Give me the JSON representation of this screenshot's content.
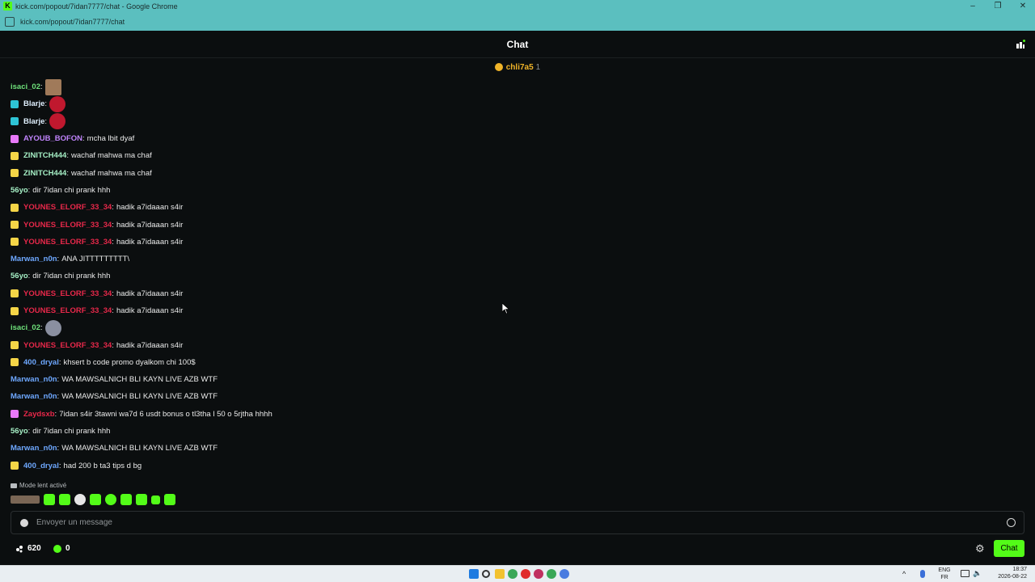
{
  "window": {
    "title": "kick.com/popout/7idan7777/chat - Google Chrome",
    "url": "kick.com/popout/7idan7777/chat"
  },
  "header": {
    "title": "Chat"
  },
  "pinned": {
    "name": "chli7a5",
    "count": "1"
  },
  "messages": [
    {
      "user": "isaci_02",
      "color": "#6ee07a",
      "badge": "",
      "text": "",
      "emote": "face"
    },
    {
      "user": "Blarje",
      "color": "#e0f0ff",
      "badge": "#2ec4d6",
      "text": "",
      "emote": "red"
    },
    {
      "user": "Blarje",
      "color": "#e0f0ff",
      "badge": "#2ec4d6",
      "text": "",
      "emote": "red"
    },
    {
      "user": "AYOUB_BOFON",
      "color": "#c084fc",
      "badge": "#e879f9",
      "text": "mcha lbit dyaf",
      "emote": ""
    },
    {
      "user": "ZINITCH444",
      "color": "#a6f0c6",
      "badge": "#f5d547",
      "text": "wachaf mahwa ma chaf",
      "emote": ""
    },
    {
      "user": "ZINITCH444",
      "color": "#a6f0c6",
      "badge": "#f5d547",
      "text": "wachaf mahwa ma chaf",
      "emote": ""
    },
    {
      "user": "56yo",
      "color": "#a6f0c6",
      "badge": "",
      "text": "dir 7idan chi prank hhh",
      "emote": ""
    },
    {
      "user": "YOUNES_ELORF_33_34",
      "color": "#e8284a",
      "badge": "#f5d547",
      "text": "hadik a7idaaan s4ir",
      "emote": ""
    },
    {
      "user": "YOUNES_ELORF_33_34",
      "color": "#e8284a",
      "badge": "#f5d547",
      "text": "hadik a7idaaan s4ir",
      "emote": ""
    },
    {
      "user": "YOUNES_ELORF_33_34",
      "color": "#e8284a",
      "badge": "#f5d547",
      "text": "hadik a7idaaan s4ir",
      "emote": ""
    },
    {
      "user": "Marwan_n0n",
      "color": "#6ea8ff",
      "badge": "",
      "text": "ANA JITTTTTTTTT\\",
      "emote": ""
    },
    {
      "user": "56yo",
      "color": "#a6f0c6",
      "badge": "",
      "text": "dir 7idan chi prank hhh",
      "emote": ""
    },
    {
      "user": "YOUNES_ELORF_33_34",
      "color": "#e8284a",
      "badge": "#f5d547",
      "text": "hadik a7idaaan s4ir",
      "emote": ""
    },
    {
      "user": "YOUNES_ELORF_33_34",
      "color": "#e8284a",
      "badge": "#f5d547",
      "text": "hadik a7idaaan s4ir",
      "emote": ""
    },
    {
      "user": "isaci_02",
      "color": "#6ee07a",
      "badge": "",
      "text": "",
      "emote": "rabbit"
    },
    {
      "user": "YOUNES_ELORF_33_34",
      "color": "#e8284a",
      "badge": "#f5d547",
      "text": "hadik a7idaaan s4ir",
      "emote": ""
    },
    {
      "user": "400_dryal",
      "color": "#6ea8ff",
      "badge": "#f5d547",
      "text": "khsert b code promo dyalkom chi 100$",
      "emote": ""
    },
    {
      "user": "Marwan_n0n",
      "color": "#6ea8ff",
      "badge": "",
      "text": "WA MAWSALNICH BLI KAYN LIVE AZB WTF",
      "emote": ""
    },
    {
      "user": "Marwan_n0n",
      "color": "#6ea8ff",
      "badge": "",
      "text": "WA MAWSALNICH BLI KAYN LIVE AZB WTF",
      "emote": ""
    },
    {
      "user": "Zaydsxb",
      "color": "#e8284a",
      "badge": "#e879f9",
      "text": "7idan s4ir 3tawni wa7d 6 usdt bonus o tl3tha l 50 o 5rjtha hhhh",
      "emote": ""
    },
    {
      "user": "56yo",
      "color": "#a6f0c6",
      "badge": "",
      "text": "dir 7idan chi prank hhh",
      "emote": ""
    },
    {
      "user": "Marwan_n0n",
      "color": "#6ea8ff",
      "badge": "",
      "text": "WA MAWSALNICH BLI KAYN LIVE AZB WTF",
      "emote": ""
    },
    {
      "user": "400_dryal",
      "color": "#6ea8ff",
      "badge": "#f5d547",
      "text": "had 200 b ta3 tips d bg",
      "emote": ""
    }
  ],
  "slow_mode": "Mode lent activé",
  "input": {
    "placeholder": "Envoyer un message"
  },
  "bottom": {
    "viewers": "620",
    "kicks": "0",
    "chat_button": "Chat"
  },
  "taskbar": {
    "lang_top": "ENG",
    "lang_bottom": "FR",
    "time": "18:37",
    "date": "2026-08-22"
  }
}
